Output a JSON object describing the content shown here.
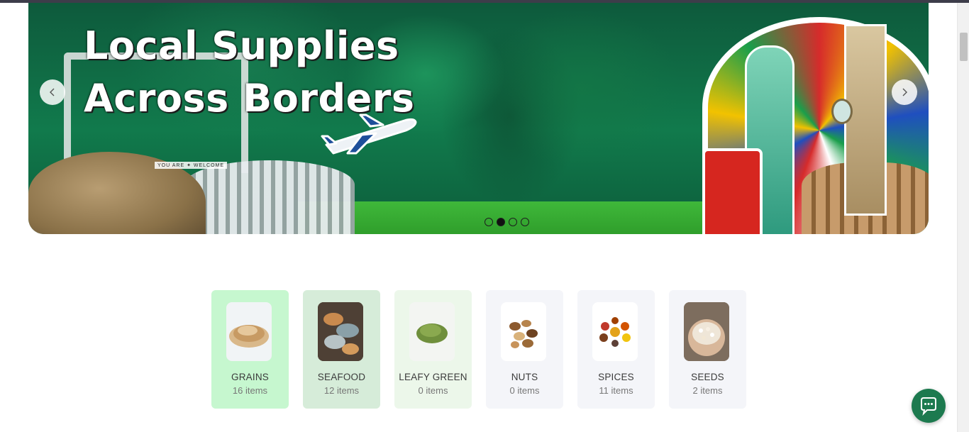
{
  "hero": {
    "title_line1": "Local Supplies",
    "title_line2": "Across Borders",
    "gate_text": "YOU ARE  ✦  WELCOME",
    "slides": [
      {
        "active": false
      },
      {
        "active": true
      },
      {
        "active": false
      },
      {
        "active": false
      }
    ],
    "prev_icon": "chevron-left-icon",
    "next_icon": "chevron-right-icon",
    "accent_color": "#117a4c"
  },
  "categories": [
    {
      "label": "GRAINS",
      "count": "16 items",
      "bg": "#c6f7cf",
      "thumb": "grains"
    },
    {
      "label": "SEAFOOD",
      "count": "12 items",
      "bg": "#d6ecd9",
      "thumb": "seafood"
    },
    {
      "label": "LEAFY GREEN",
      "count": "0 items",
      "bg": "#ecf7ea",
      "thumb": "leafy-green"
    },
    {
      "label": "NUTS",
      "count": "0 items",
      "bg": "#f4f5f9",
      "thumb": "nuts"
    },
    {
      "label": "SPICES",
      "count": "11 items",
      "bg": "#f4f5f9",
      "thumb": "spices"
    },
    {
      "label": "SEEDS",
      "count": "2 items",
      "bg": "#f4f5f9",
      "thumb": "seeds"
    }
  ],
  "chat": {
    "icon": "chat-bubble-icon",
    "color": "#1d7a4f"
  }
}
